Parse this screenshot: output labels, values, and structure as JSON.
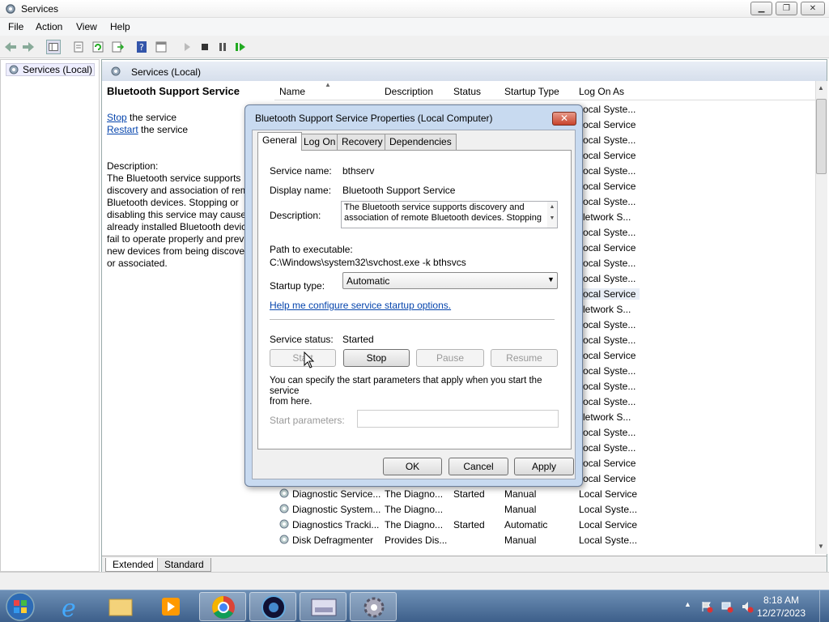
{
  "window": {
    "title": "Services"
  },
  "menu": [
    "File",
    "Action",
    "View",
    "Help"
  ],
  "tree": {
    "item": "Services (Local)"
  },
  "pane_header": "Services (Local)",
  "left_desc": {
    "title": "Bluetooth Support Service",
    "stop_link": "Stop",
    "stop_rest": " the service",
    "restart_link": "Restart",
    "restart_rest": " the service",
    "desc_label": "Description:",
    "desc_lines": [
      "The Bluetooth service supports",
      "discovery and association of rem",
      "Bluetooth devices.  Stopping or",
      "disabling this service may cause",
      "already installed Bluetooth devic",
      "fail to operate properly and prev",
      "new devices from being discove",
      "or associated."
    ]
  },
  "columns": {
    "name": "Name",
    "description": "Description",
    "status": "Status",
    "startup": "Startup Type",
    "logon": "Log On As"
  },
  "logon_partial": [
    "ocal Syste...",
    "ocal Service",
    "ocal Syste...",
    "ocal Service",
    "ocal Syste...",
    "ocal Service",
    "ocal Syste...",
    "letwork S...",
    "ocal Syste...",
    "ocal Service",
    "ocal Syste...",
    "ocal Syste...",
    "ocal Service",
    "letwork S...",
    "ocal Syste...",
    "ocal Syste...",
    "ocal Service",
    "ocal Syste...",
    "ocal Syste...",
    "ocal Syste...",
    "letwork S...",
    "ocal Syste...",
    "ocal Syste...",
    "ocal Service",
    "ocal Service"
  ],
  "rows": [
    {
      "name": "Diagnostic Service...",
      "desc": "The Diagno...",
      "status": "Started",
      "startup": "Manual",
      "logon": "Local Service"
    },
    {
      "name": "Diagnostic System...",
      "desc": "The Diagno...",
      "status": "",
      "startup": "Manual",
      "logon": "Local Syste..."
    },
    {
      "name": "Diagnostics Tracki...",
      "desc": "The Diagno...",
      "status": "Started",
      "startup": "Automatic",
      "logon": "Local Service"
    },
    {
      "name": "Disk Defragmenter",
      "desc": "Provides Dis...",
      "status": "",
      "startup": "Manual",
      "logon": "Local Syste..."
    }
  ],
  "bottom_tabs": [
    "Extended",
    "Standard"
  ],
  "dialog": {
    "title": "Bluetooth Support Service Properties (Local Computer)",
    "tabs": [
      "General",
      "Log On",
      "Recovery",
      "Dependencies"
    ],
    "service_name_label": "Service name:",
    "service_name": "bthserv",
    "display_name_label": "Display name:",
    "display_name": "Bluetooth Support Service",
    "description_label": "Description:",
    "description_lines": [
      "The Bluetooth service supports discovery and",
      "association of remote Bluetooth devices.  Stopping"
    ],
    "path_label": "Path to executable:",
    "path": "C:\\Windows\\system32\\svchost.exe -k bthsvcs",
    "startup_label": "Startup type:",
    "startup_value": "Automatic",
    "help_link": "Help me configure service startup options.",
    "status_label": "Service status:",
    "status_value": "Started",
    "btn_start": "Start",
    "btn_stop": "Stop",
    "btn_pause": "Pause",
    "btn_resume": "Resume",
    "note_lines": [
      "You can specify the start parameters that apply when you start the service",
      "from here."
    ],
    "params_label": "Start parameters:",
    "ok": "OK",
    "cancel": "Cancel",
    "apply": "Apply"
  },
  "clock": {
    "time": "8:18 AM",
    "date": "12/27/2023"
  }
}
